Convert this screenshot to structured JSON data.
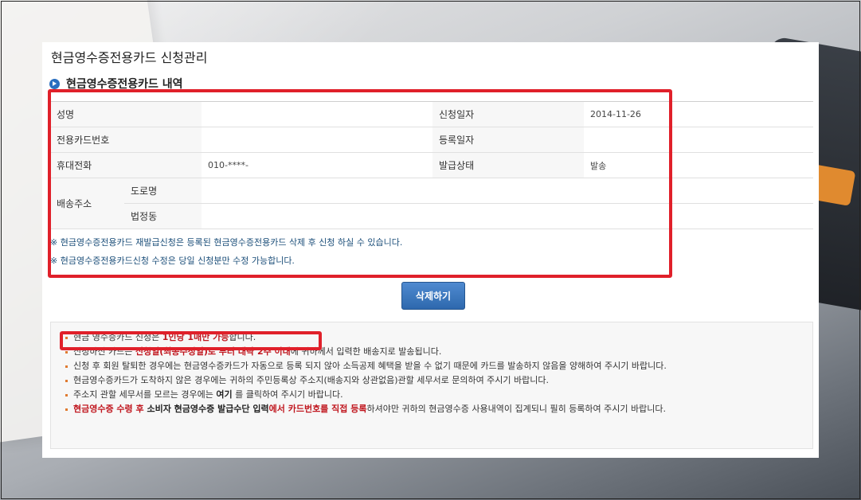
{
  "page": {
    "title": "현금영수증전용카드 신청관리",
    "section_title": "현금영수증전용카드 내역"
  },
  "info": {
    "name_label": "성명",
    "name_value": "",
    "apply_date_label": "신청일자",
    "apply_date_value": "2014-11-26",
    "card_no_label": "전용카드번호",
    "card_no_value": "",
    "reg_date_label": "등록일자",
    "reg_date_value": "",
    "phone_label": "휴대전화",
    "phone_value": "010-****-",
    "issue_status_label": "발급상태",
    "issue_status_value": "발송",
    "address_label": "배송주소",
    "road_label": "도로명",
    "road_value": "",
    "lot_label": "법정동",
    "lot_value": ""
  },
  "notices": [
    "※ 현금영수증전용카드 재발급신청은 등록된 현금영수증전용카드 삭제 후 신청 하실 수 있습니다.",
    "※ 현금영수증전용카드신청 수정은 당일 신청분만 수정 가능합니다."
  ],
  "buttons": {
    "delete": "삭제하기"
  },
  "guide": {
    "line1_a": "현금 영수증카드 신청은 ",
    "line1_b": "1인당 1매만 가능",
    "line1_c": "합니다.",
    "line2_a": "신청하신 카드는 ",
    "line2_b": "신청일(최종수정일)로 부터 대략 2주 이내",
    "line2_c": "에 귀하께서 입력한 배송지로 발송됩니다.",
    "line3": "신청 후 회원 탈퇴한 경우에는 현금영수증카드가 자동으로 등록 되지 않아 소득공제 혜택을 받을 수 없기 때문에 카드를 발송하지 않음을 양해하여 주시기 바랍니다.",
    "line4": "현금영수증카드가 도착하지 않은 경우에는 귀하의 주민등록상 주소지(배송지와 상관없음)관할 세무서로 문의하여 주시기 바랍니다.",
    "line5_a": "주소지 관할 세무서를 모르는 경우에는 ",
    "line5_b": "여기",
    "line5_c": " 를 클릭하여 주시기 바랍니다.",
    "line6_a": "현금영수증 수령 후 ",
    "line6_b": "소비자 현금영수증 발급수단 입력",
    "line6_c": "에서 ",
    "line6_d": "카드번호를 직접 등록",
    "line6_e": "하셔야만 귀하의 현금영수증 사용내역이 집계되니 필히 등록하여 주시기 바랍니다."
  },
  "colors": {
    "highlight_border": "#e0202a",
    "accent_blue": "#2e68ad",
    "emphasis_red": "#c0161e"
  }
}
